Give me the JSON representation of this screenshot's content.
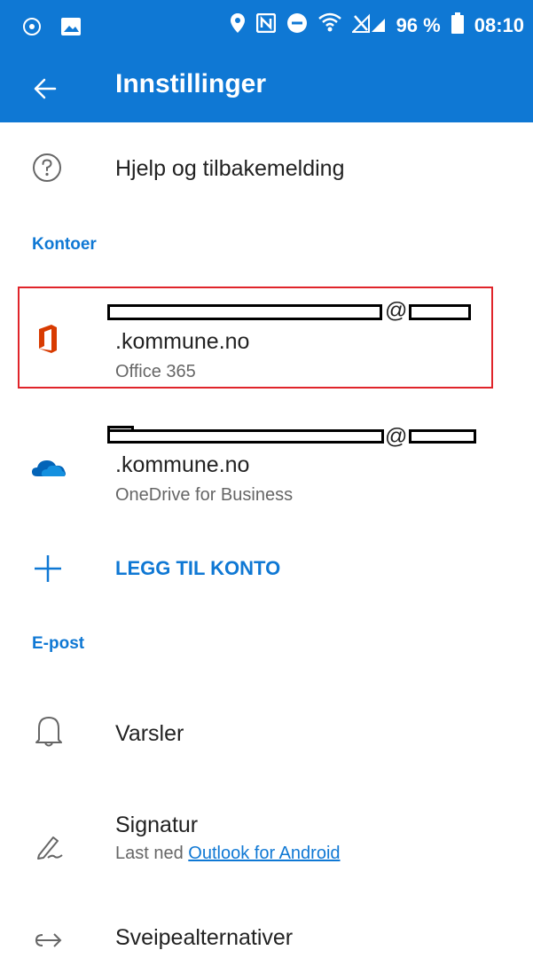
{
  "status_bar": {
    "battery_text": "96 %",
    "time": "08:10",
    "left_icons": [
      "app-icon",
      "image-icon"
    ],
    "right_icons": [
      "location-icon",
      "nfc-icon",
      "dnd-icon",
      "wifi-icon",
      "signal-icon",
      "battery-icon"
    ]
  },
  "header": {
    "title": "Innstillinger",
    "back_icon": "arrow-left-icon",
    "background": "#0f78d4"
  },
  "help": {
    "label": "Hjelp og tilbakemelding",
    "icon": "help-circle-icon"
  },
  "accounts_section": {
    "title": "Kontoer"
  },
  "accounts": [
    {
      "at": "@",
      "domain": ".kommune.no",
      "type": "Office 365",
      "icon": "office-icon"
    },
    {
      "at": "@",
      "domain": ".kommune.no",
      "type": "OneDrive for Business",
      "icon": "onedrive-icon"
    }
  ],
  "add_account": {
    "label": "LEGG TIL KONTO",
    "icon": "plus-icon"
  },
  "email_section": {
    "title": "E-post"
  },
  "email_items": {
    "notifications": {
      "label": "Varsler",
      "icon": "bell-icon"
    },
    "signature": {
      "label": "Signatur",
      "sub_prefix": "Last ned ",
      "sub_link": "Outlook for Android",
      "icon": "signature-icon"
    },
    "swipe": {
      "label": "Sveipealternativer",
      "icon": "swipe-icon"
    }
  },
  "colors": {
    "accent": "#0f78d4",
    "highlight": "#e0242a",
    "office": "#d83b01",
    "onedrive": "#0364b8"
  }
}
